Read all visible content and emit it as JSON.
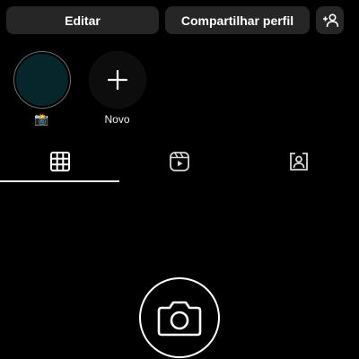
{
  "actions": {
    "edit_label": "Editar",
    "share_label": "Compartilhar perfil",
    "add_user_icon": "add-person-icon"
  },
  "highlights": [
    {
      "label": "📸",
      "kind": "story"
    },
    {
      "label": "Novo",
      "kind": "new",
      "icon": "plus-icon"
    }
  ],
  "tabs": [
    {
      "name": "posts",
      "icon": "grid-icon",
      "selected": true
    },
    {
      "name": "reels",
      "icon": "reels-icon",
      "selected": false
    },
    {
      "name": "tagged",
      "icon": "tagged-person-icon",
      "selected": false
    }
  ],
  "empty_state": {
    "icon": "camera-icon"
  },
  "colors": {
    "background": "#000000",
    "button": "#262626",
    "story_fill": "#06262b",
    "text": "#ffffff"
  }
}
